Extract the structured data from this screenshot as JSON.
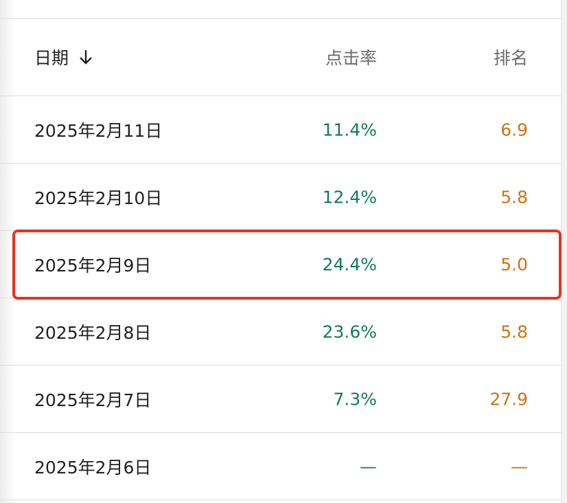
{
  "table": {
    "header": {
      "date_label": "日期",
      "ctr_label": "点击率",
      "rank_label": "排名",
      "sort_icon": "arrow-down-icon"
    },
    "rows": [
      {
        "date": "2025年2月11日",
        "ctr": "11.4%",
        "rank": "6.9"
      },
      {
        "date": "2025年2月10日",
        "ctr": "12.4%",
        "rank": "5.8"
      },
      {
        "date": "2025年2月9日",
        "ctr": "24.4%",
        "rank": "5.0"
      },
      {
        "date": "2025年2月8日",
        "ctr": "23.6%",
        "rank": "5.8"
      },
      {
        "date": "2025年2月7日",
        "ctr": "7.3%",
        "rank": "27.9"
      },
      {
        "date": "2025年2月6日",
        "ctr": "—",
        "rank": "—"
      }
    ]
  },
  "colors": {
    "ctr": "#137a5e",
    "rank": "#d1720f",
    "highlight": "#e8321d"
  }
}
